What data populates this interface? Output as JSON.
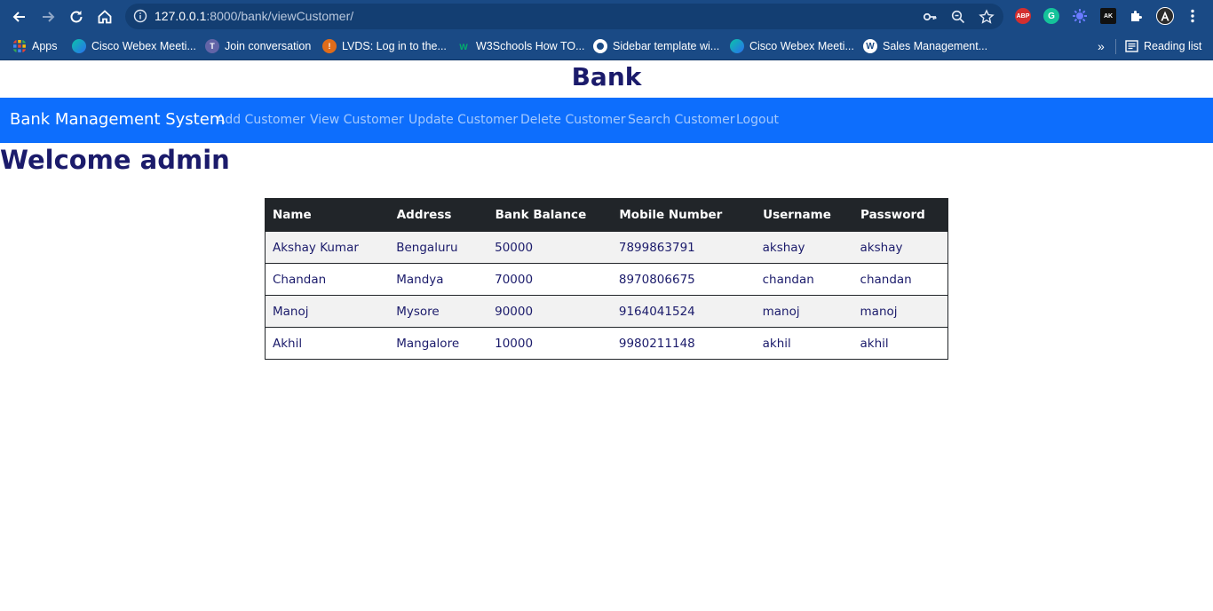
{
  "browser": {
    "url_host": "127.0.0.1",
    "url_rest": ":8000/bank/viewCustomer/",
    "extensions": [
      "ABP",
      "G",
      "AK"
    ],
    "bookmarks": [
      {
        "label": "Apps",
        "icon": "apps-grid-icon"
      },
      {
        "label": "Cisco Webex Meeti...",
        "icon": "webex-icon"
      },
      {
        "label": "Join conversation",
        "icon": "teams-icon"
      },
      {
        "label": "LVDS: Log in to the...",
        "icon": "lvds-icon"
      },
      {
        "label": "W3Schools How TO...",
        "icon": "w3schools-icon"
      },
      {
        "label": "Sidebar template wi...",
        "icon": "github-icon"
      },
      {
        "label": "Cisco Webex Meeti...",
        "icon": "webex-icon"
      },
      {
        "label": "Sales Management...",
        "icon": "wordpress-icon"
      }
    ],
    "more_label": "»",
    "reading_list": "Reading list"
  },
  "page": {
    "heading": "Bank",
    "navbar": {
      "brand": "Bank Management System",
      "links": [
        "Add Customer",
        "View Customer",
        "Update Customer",
        "Delete Customer",
        "Search Customer",
        "Logout"
      ]
    },
    "welcome": "Welcome admin",
    "table": {
      "headers": [
        "Name",
        "Address",
        "Bank Balance",
        "Mobile Number",
        "Username",
        "Password"
      ],
      "rows": [
        [
          "Akshay Kumar",
          "Bengaluru",
          "50000",
          "7899863791",
          "akshay",
          "akshay"
        ],
        [
          "Chandan",
          "Mandya",
          "70000",
          "8970806675",
          "chandan",
          "chandan"
        ],
        [
          "Manoj",
          "Mysore",
          "90000",
          "9164041524",
          "manoj",
          "manoj"
        ],
        [
          "Akhil",
          "Mangalore",
          "10000",
          "9980211148",
          "akhil",
          "akhil"
        ]
      ]
    }
  },
  "colors": {
    "chrome": "#1a4a85",
    "navbar": "#0d6efd",
    "heading": "#1b1b6b",
    "table_header": "#212529"
  }
}
